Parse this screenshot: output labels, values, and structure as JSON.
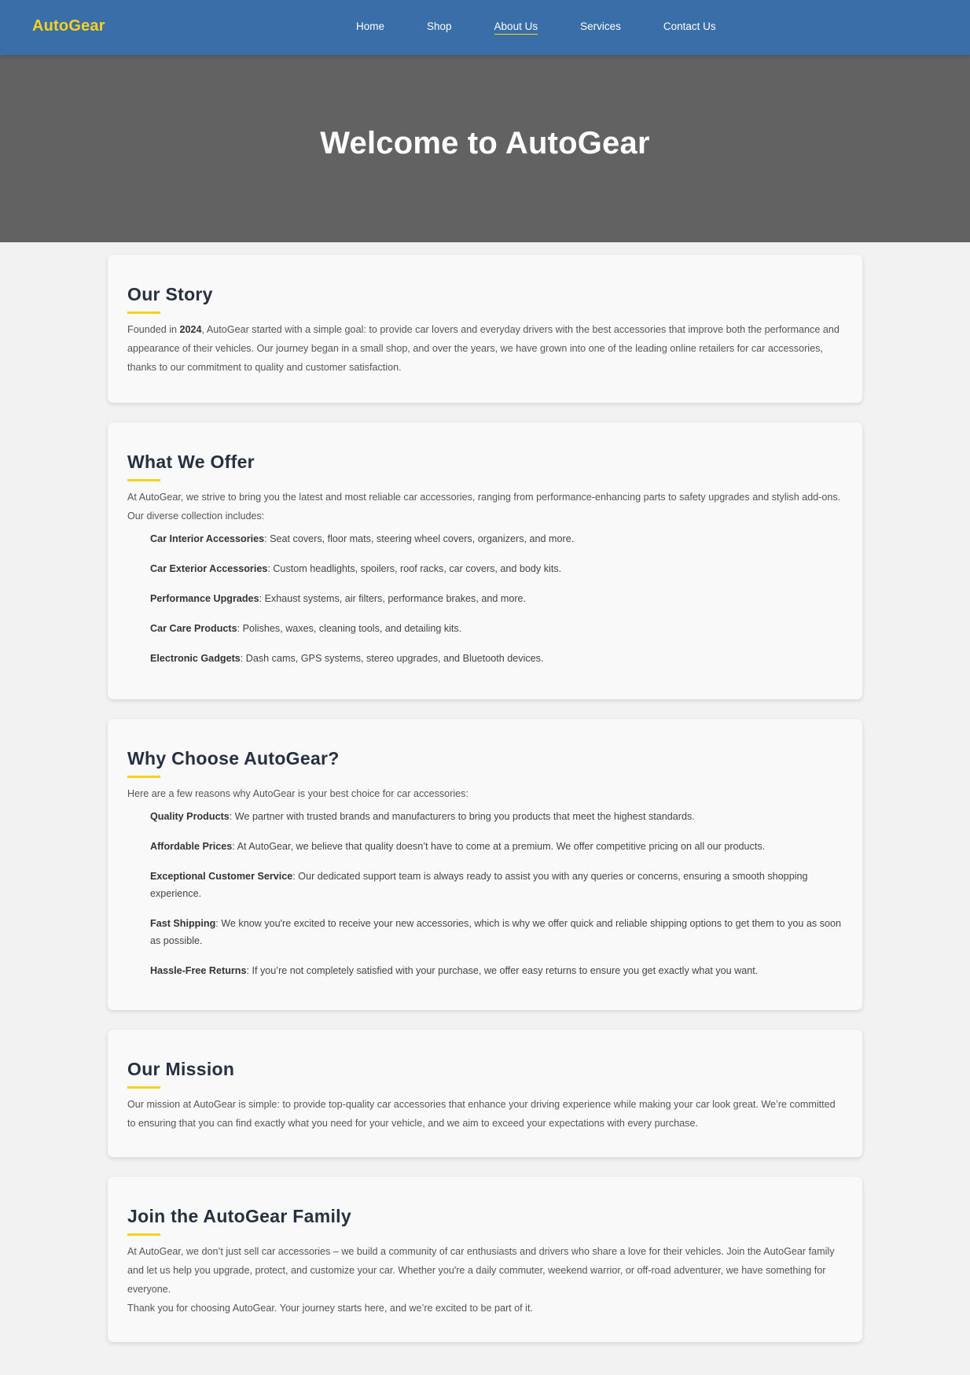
{
  "header": {
    "logo": "AutoGear",
    "nav": [
      "Home",
      "Shop",
      "About Us",
      "Services",
      "Contact Us"
    ]
  },
  "hero": {
    "title": "Welcome to AutoGear"
  },
  "story": {
    "title": "Our Story",
    "text_before": "Founded in ",
    "year": "2024",
    "text_after": ", AutoGear started with a simple goal: to provide car lovers and everyday drivers with the best accessories that improve both the performance and appearance of their vehicles. Our journey began in a small shop, and over the years, we have grown into one of the leading online retailers for car accessories, thanks to our commitment to quality and customer satisfaction."
  },
  "offer": {
    "title": "What We Offer",
    "intro": "At AutoGear, we strive to bring you the latest and most reliable car accessories, ranging from performance-enhancing parts to safety upgrades and stylish add-ons. Our diverse collection includes:",
    "items": [
      {
        "name": "Car Interior Accessories",
        "desc": ": Seat covers, floor mats, steering wheel covers, organizers, and more."
      },
      {
        "name": "Car Exterior Accessories",
        "desc": ": Custom headlights, spoilers, roof racks, car covers, and body kits."
      },
      {
        "name": "Performance Upgrades",
        "desc": ": Exhaust systems, air filters, performance brakes, and more."
      },
      {
        "name": "Car Care Products",
        "desc": ": Polishes, waxes, cleaning tools, and detailing kits."
      },
      {
        "name": "Electronic Gadgets",
        "desc": ": Dash cams, GPS systems, stereo upgrades, and Bluetooth devices."
      }
    ]
  },
  "why": {
    "title": "Why Choose AutoGear?",
    "intro": "Here are a few reasons why AutoGear is your best choice for car accessories:",
    "items": [
      {
        "name": "Quality Products",
        "desc": ": We partner with trusted brands and manufacturers to bring you products that meet the highest standards."
      },
      {
        "name": "Affordable Prices",
        "desc": ": At AutoGear, we believe that quality doesn’t have to come at a premium. We offer competitive pricing on all our products."
      },
      {
        "name": "Exceptional Customer Service",
        "desc": ": Our dedicated support team is always ready to assist you with any queries or concerns, ensuring a smooth shopping experience."
      },
      {
        "name": "Fast Shipping",
        "desc": ": We know you're excited to receive your new accessories, which is why we offer quick and reliable shipping options to get them to you as soon as possible."
      },
      {
        "name": "Hassle-Free Returns",
        "desc": ": If you’re not completely satisfied with your purchase, we offer easy returns to ensure you get exactly what you want."
      }
    ]
  },
  "mission": {
    "title": "Our Mission",
    "text": "Our mission at AutoGear is simple: to provide top-quality car accessories that enhance your driving experience while making your car look great. We’re committed to ensuring that you can find exactly what you need for your vehicle, and we aim to exceed your expectations with every purchase."
  },
  "family": {
    "title": "Join the AutoGear Family",
    "text1": "At AutoGear, we don’t just sell car accessories – we build a community of car enthusiasts and drivers who share a love for their vehicles. Join the AutoGear family and let us help you upgrade, protect, and customize your car. Whether you're a daily commuter, weekend warrior, or off-road adventurer, we have something for everyone.",
    "text2": "Thank you for choosing AutoGear. Your journey starts here, and we’re excited to be part of it."
  },
  "colors": {
    "navbar": "#3a6ea8",
    "accent": "#f5d21f",
    "hero": "#626262",
    "heading": "#26303f"
  }
}
